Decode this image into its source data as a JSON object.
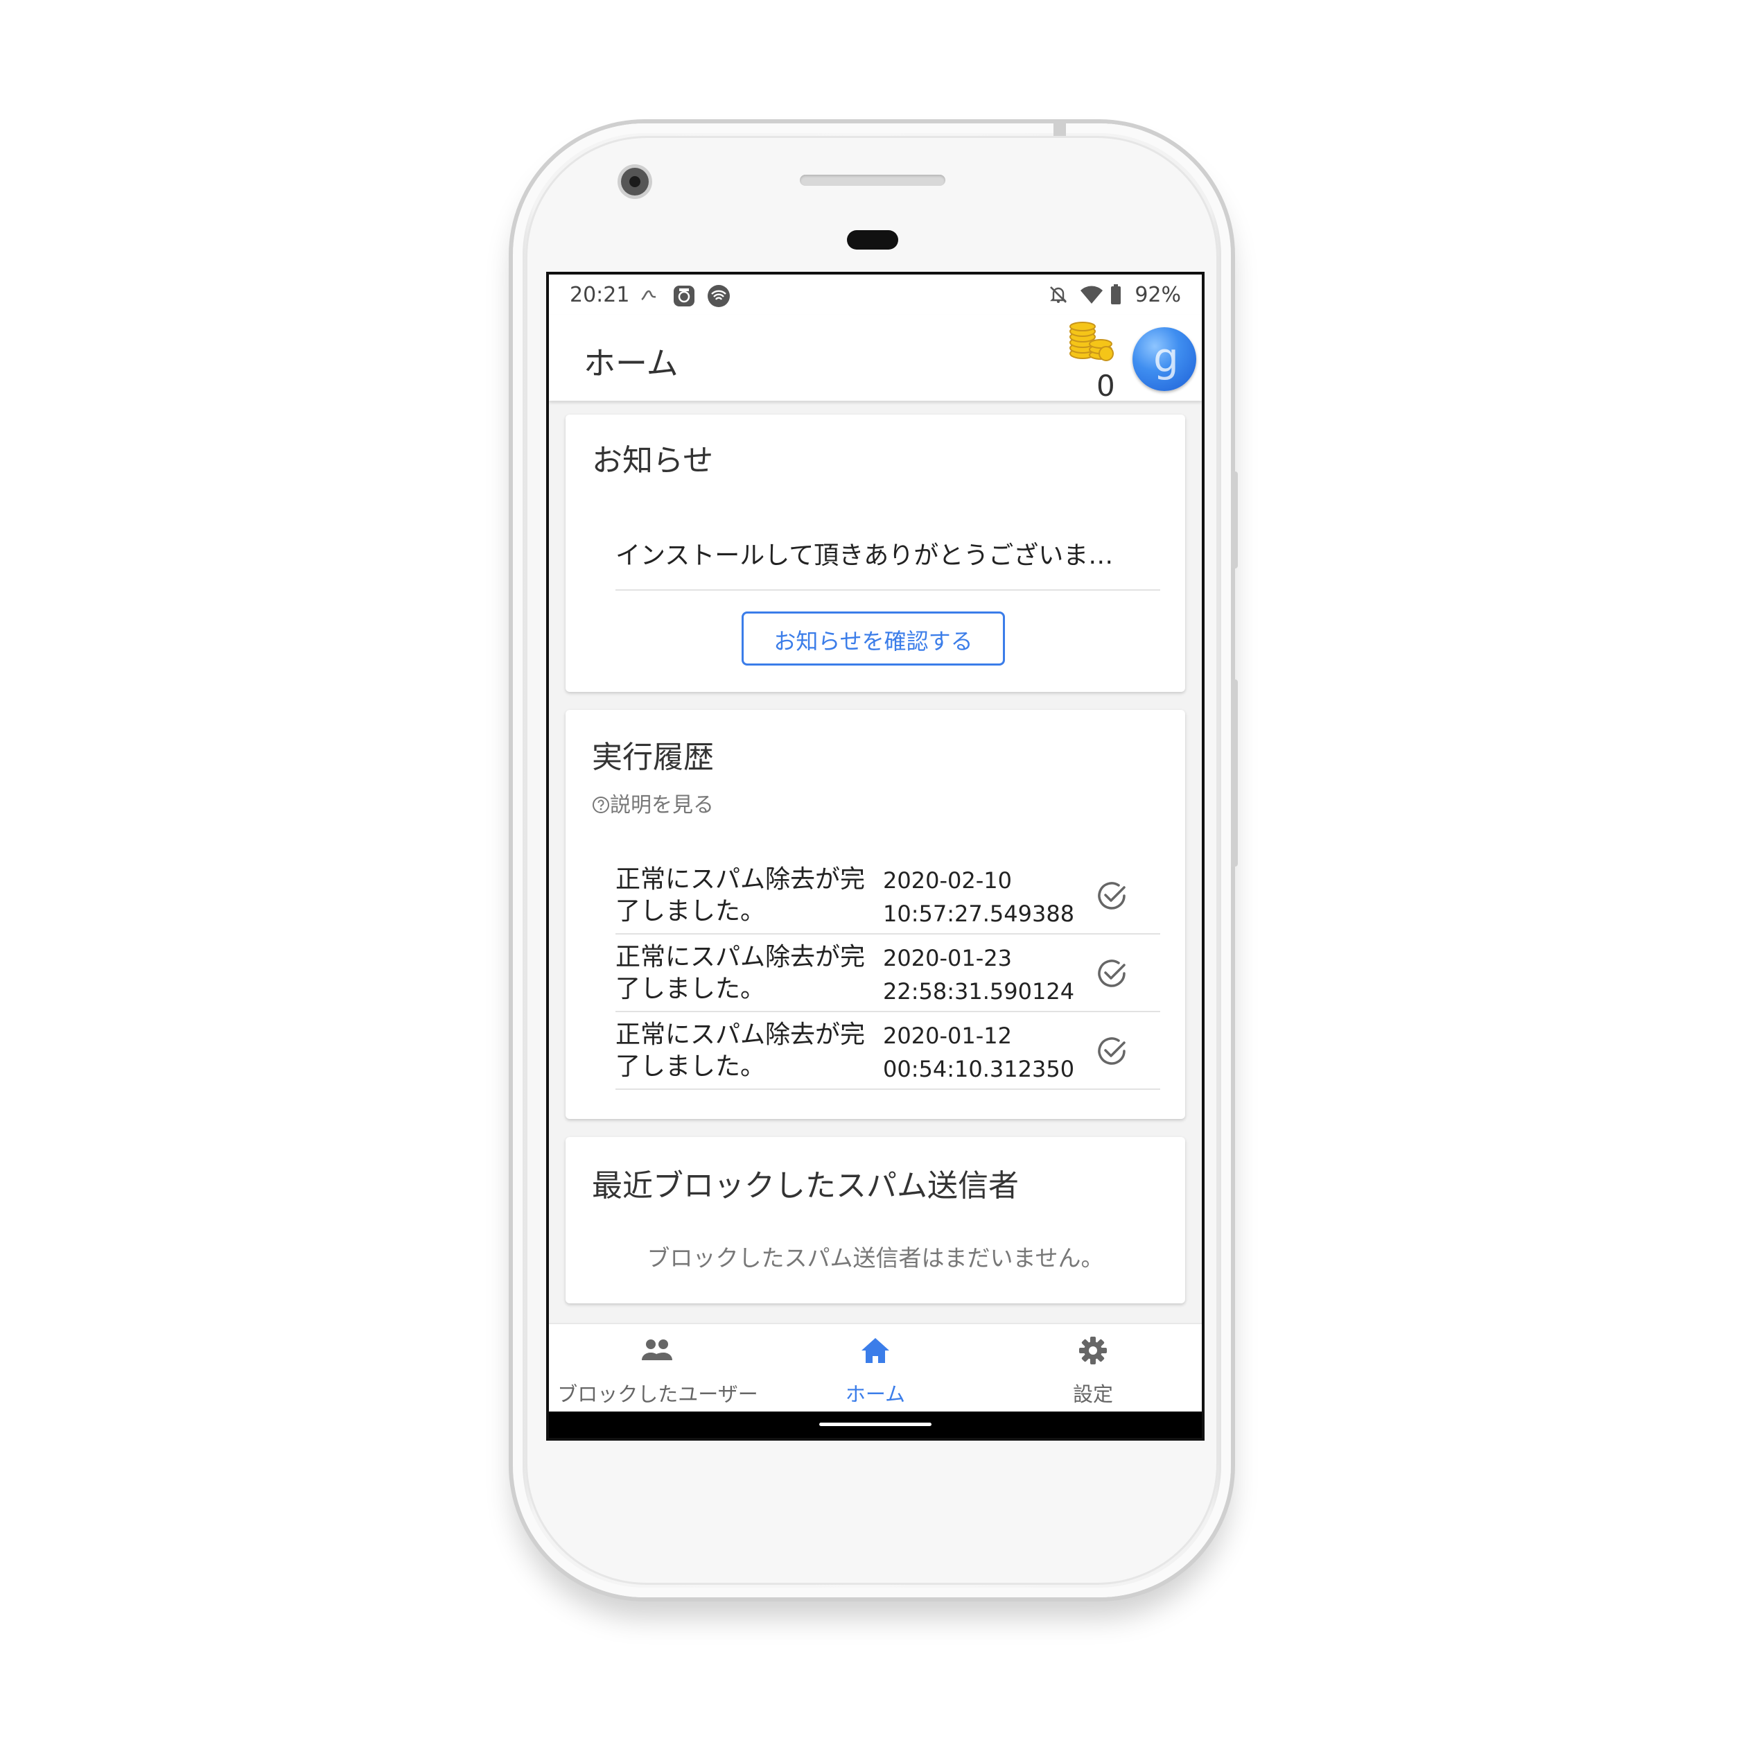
{
  "status_bar": {
    "time": "20:21",
    "left_icons": [
      "notification-icon",
      "camera-app-icon",
      "wifi-app-icon"
    ],
    "right_icons": [
      "bell-off-icon",
      "wifi-signal-icon",
      "battery-icon"
    ],
    "battery": "92%"
  },
  "app_bar": {
    "title": "ホーム",
    "coin_count": "0"
  },
  "notice_card": {
    "title": "お知らせ",
    "latest": "インストールして頂きありがとうございま…",
    "button": "お知らせを確認する"
  },
  "history_card": {
    "title": "実行履歴",
    "help": "説明を見る",
    "rows": [
      {
        "message": "正常にスパム除去が完了しました。",
        "date": "2020-02-10",
        "time": "10:57:27.549388"
      },
      {
        "message": "正常にスパム除去が完了しました。",
        "date": "2020-01-23",
        "time": "22:58:31.590124"
      },
      {
        "message": "正常にスパム除去が完了しました。",
        "date": "2020-01-12",
        "time": "00:54:10.312350"
      }
    ]
  },
  "blocked_card": {
    "title": "最近ブロックしたスパム送信者",
    "empty": "ブロックしたスパム送信者はまだいません。"
  },
  "bottom_nav": {
    "items": [
      {
        "label": "ブロックしたユーザー",
        "icon": "people-icon",
        "active": false
      },
      {
        "label": "ホーム",
        "icon": "home-icon",
        "active": true
      },
      {
        "label": "設定",
        "icon": "gear-icon",
        "active": false
      }
    ]
  },
  "colors": {
    "accent": "#3b7de9",
    "text": "#222222",
    "muted": "#777777",
    "background": "#f3f3f3"
  }
}
